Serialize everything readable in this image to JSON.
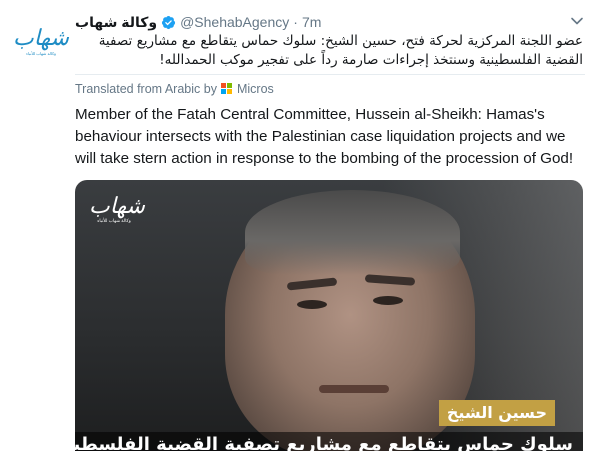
{
  "tweet": {
    "display_name": "وكالة شهاب",
    "handle": "@ShehabAgency",
    "separator": "·",
    "time": "7m",
    "verified": true,
    "avatar": {
      "logo_text": "شهاب",
      "logo_sub": "وكالة شهاب للأنباء",
      "brand_color": "#1e8cc4"
    },
    "text_original": "عضو اللجنة المركزية لحركة فتح، حسين الشيخ: سلوك حماس يتقاطع مع مشاريع تصفية القضية الفلسطينية وسنتخذ إجراءات صارمة رداً على تفجير موكب الحمدالله!",
    "translation": {
      "label": "Translated from Arabic by",
      "provider": "Micros",
      "text": "Member of the Fatah Central Committee, Hussein al-Sheikh: Hamas's behaviour intersects with the Palestinian case liquidation projects and we will take stern action in response to the bombing of the procession of God!"
    },
    "media": {
      "logo_text": "شهاب",
      "logo_sub": "وكالة شهاب للأنباء",
      "name_overlay": "حسين الشيخ",
      "caption": "سلوك حماس يتقاطع مع مشاريع تصفية القضية الفلسطينية",
      "name_box_color": "#c2a044"
    }
  },
  "colors": {
    "text_primary": "#14171a",
    "text_secondary": "#657786",
    "verified_blue": "#1da1f2",
    "divider": "#e6ecf0"
  },
  "icons": {
    "verified": "verified-badge-icon",
    "caret": "chevron-down-icon",
    "microsoft": "microsoft-logo-icon"
  }
}
